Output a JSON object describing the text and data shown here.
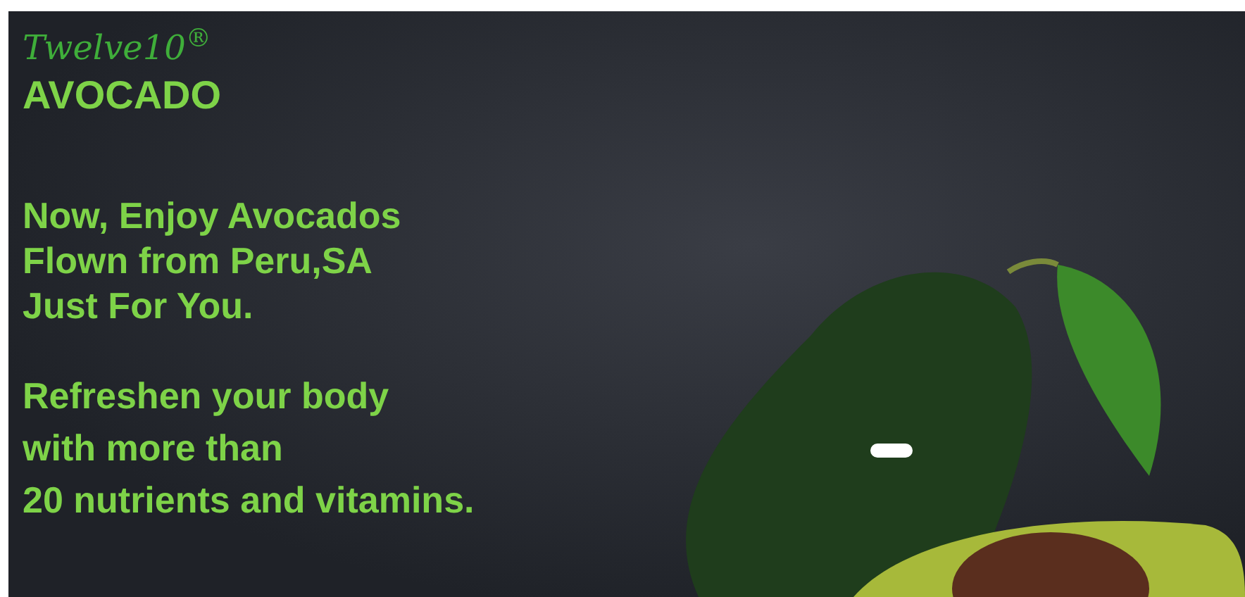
{
  "banner": {
    "brand": "Twelve10$^{®}$",
    "product": "AVOCADO",
    "headline": [
      "Now, Enjoy Avocados",
      "Flown from Peru,SA",
      "Just For You."
    ],
    "subline": [
      "Refreshen your body",
      "with more than",
      "20 nutrients and vitamins."
    ]
  }
}
